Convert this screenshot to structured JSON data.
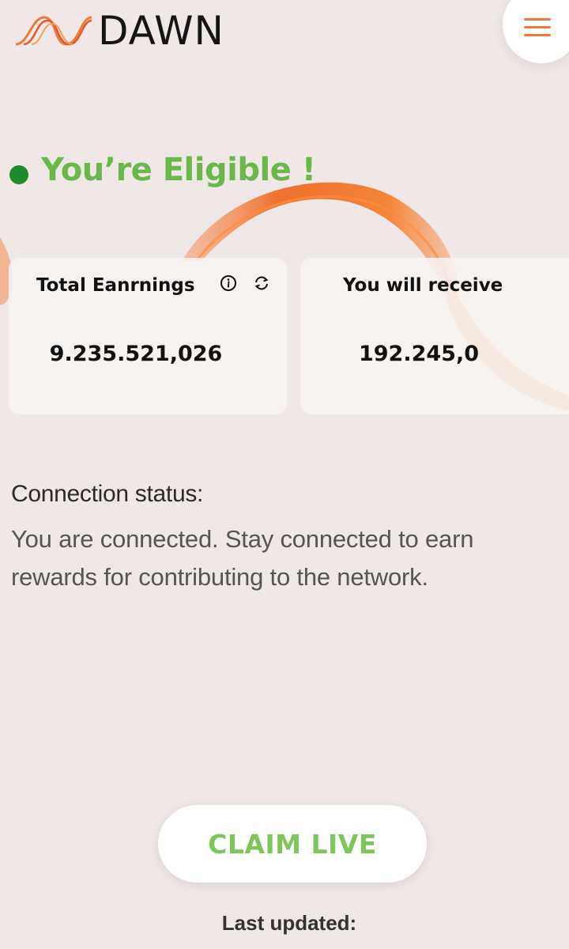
{
  "header": {
    "brand": "DAWN",
    "accent_color": "#f07a3a",
    "menu_icon": "hamburger-menu-icon"
  },
  "eligibility": {
    "title": "You’re Eligible !",
    "status_color": "#1f8a2a",
    "title_color": "#6ab84a"
  },
  "cards": {
    "earnings": {
      "label": "Total Eanrnings",
      "value": "9.235.521,026",
      "info_icon": "info-icon",
      "refresh_icon": "refresh-icon"
    },
    "receive": {
      "label": "You will receive",
      "value": "192.245,0"
    }
  },
  "connection": {
    "label": "Connection status:",
    "text": "You are connected. Stay connected to earn rewards for contributing to the network."
  },
  "claim": {
    "label": "CLAIM LIVE",
    "color": "#7cc65a"
  },
  "footer": {
    "last_updated_label": "Last updated:"
  }
}
